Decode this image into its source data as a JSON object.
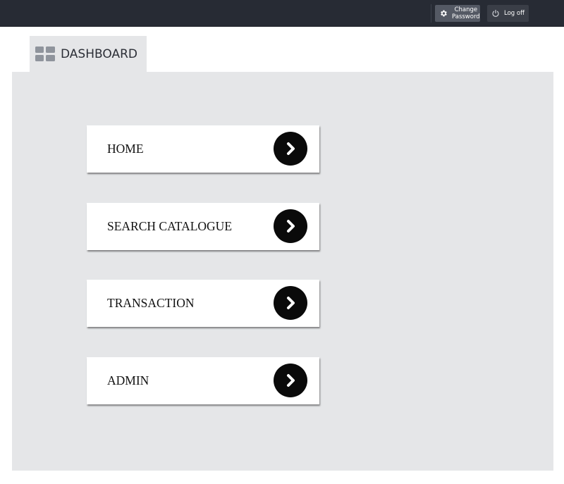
{
  "topbar": {
    "change_password_label": "Change\nPassword",
    "logoff_label": "Log off"
  },
  "tab": {
    "label": "DASHBOARD"
  },
  "menu": {
    "items": [
      {
        "label": "HOME"
      },
      {
        "label": "SEARCH CATALOGUE"
      },
      {
        "label": "TRANSACTION"
      },
      {
        "label": "ADMIN"
      }
    ]
  },
  "icons": {
    "change_password": "gear-icon",
    "logoff": "power-icon",
    "tab": "dashboard-grid-icon",
    "menu_arrow": "chevron-right-icon"
  },
  "colors": {
    "topbar_bg": "#272b34",
    "panel_bg": "#e5e6e8",
    "arrow_circle": "#0a0a0a"
  }
}
